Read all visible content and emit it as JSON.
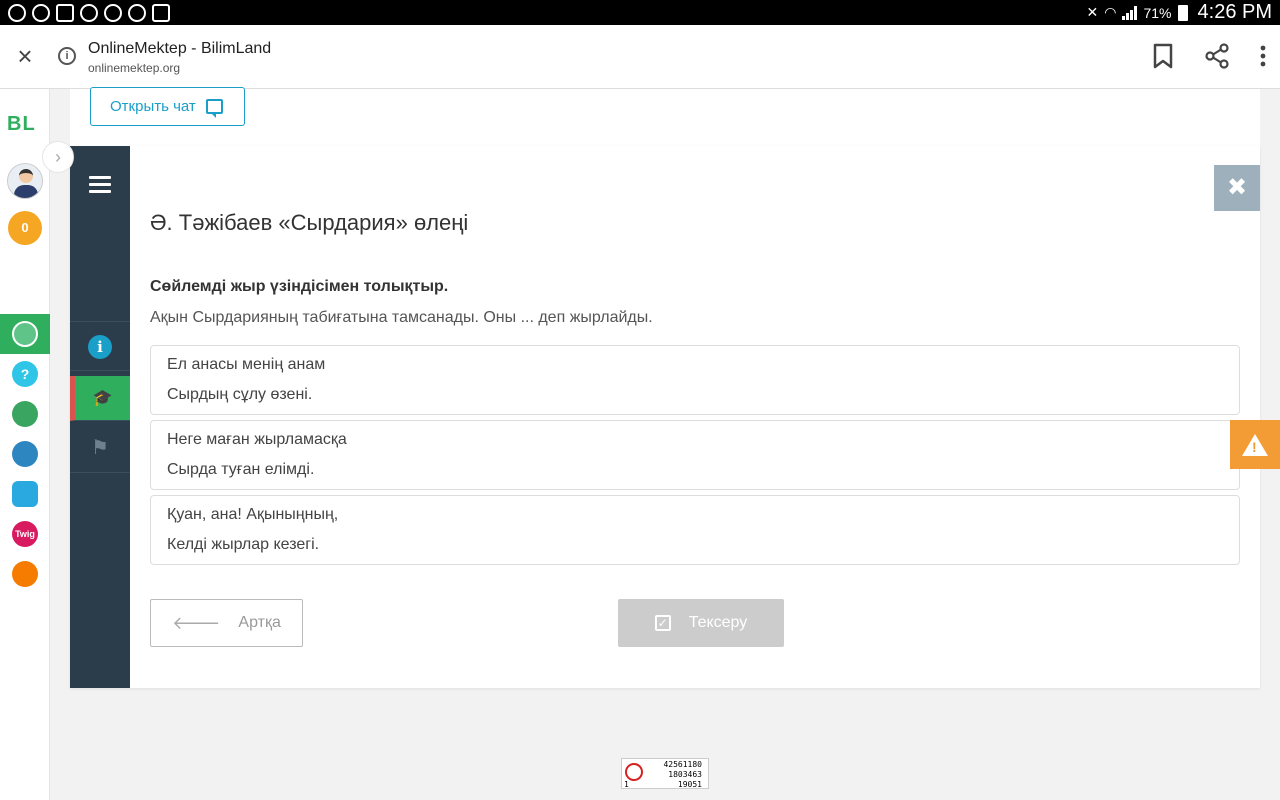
{
  "status_bar": {
    "battery": "71%",
    "time": "4:26 PM"
  },
  "browser": {
    "title": "OnlineMektep - BilimLand",
    "url": "onlinemektep.org"
  },
  "sidebar": {
    "logo": "BL",
    "coins": "0",
    "apps": [
      {
        "icon": "onlinemektep-icon",
        "color": "#2fae5e"
      },
      {
        "icon": "help-icon",
        "color": "#2fc5e6",
        "label": "?"
      },
      {
        "icon": "bilimland-icon",
        "color": "#3aa561"
      },
      {
        "icon": "bilimbook-icon",
        "color": "#2e86c1"
      },
      {
        "icon": "test-icon",
        "color": "#2aa8e0"
      },
      {
        "icon": "twig-icon",
        "color": "#d81b60",
        "label": "Twig"
      },
      {
        "icon": "imagine-icon",
        "color": "#f57c00"
      }
    ]
  },
  "chat": {
    "open_chat_label": "Открыть чат"
  },
  "lesson": {
    "title": "Ә. Тәжібаев «Сырдария» өлеңі",
    "task_title": "Сөйлемді жыр үзіндісімен толықтыр.",
    "task_text": "Ақын Сырдарияның табиғатына тамсанады. Оны ... деп жырлайды.",
    "options": [
      {
        "line1": "Ел анасы менің анам",
        "line2": "Сырдың сұлу өзені."
      },
      {
        "line1": "Неге маған жырламасқа",
        "line2": "Сырда туған елімді."
      },
      {
        "line1": "Қуан, ана! Ақыныңның,",
        "line2": "Келді жырлар кезегі."
      }
    ],
    "back_label": "Артқа",
    "check_label": "Тексеру"
  },
  "counter": {
    "line1": "42561180",
    "line2": "1803463",
    "line3": "19051",
    "corner": "1"
  },
  "colors": {
    "accent_green": "#2fae5e",
    "accent_blue": "#1a9fc9",
    "nav_dark": "#2b3c4a",
    "warning": "#f39c35"
  }
}
